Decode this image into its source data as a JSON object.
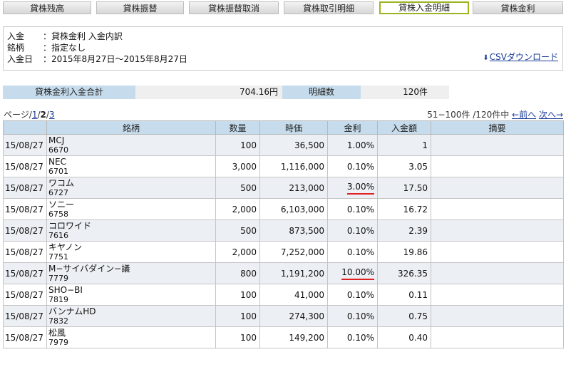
{
  "tabs": [
    {
      "label": "貸株残高",
      "active": false
    },
    {
      "label": "貸株振替",
      "active": false
    },
    {
      "label": "貸株振替取消",
      "active": false
    },
    {
      "label": "貸株取引明細",
      "active": false
    },
    {
      "label": "貸株入金明細",
      "active": true
    },
    {
      "label": "貸株金利",
      "active": false
    }
  ],
  "info": {
    "deposit_label": "入金",
    "deposit_value": "：貸株金利 入金内訳",
    "stock_label": "銘柄",
    "stock_value": "：指定なし",
    "date_label": "入金日",
    "date_value": "：2015年8月27日～2015年8月27日",
    "csv_link": "CSVダウンロード",
    "csv_icon": "download-arrow-icon"
  },
  "summary": {
    "total_label": "貸株金利入金合計",
    "total_value": "704.16円",
    "count_label": "明細数",
    "count_value": "120件"
  },
  "pager": {
    "prefix": "ページ",
    "slash1": "/",
    "page1": "1",
    "slash2": "/",
    "page2": "2",
    "slash3": "/",
    "page3": "3",
    "range": "51−100件 /120件中",
    "prev": "←前へ",
    "next": "次へ→"
  },
  "table": {
    "headers": [
      "",
      "銘柄",
      "数量",
      "時価",
      "金利",
      "入金額",
      "摘要"
    ],
    "rows": [
      {
        "date": "15/08/27",
        "name": "MCJ",
        "code": "6670",
        "qty": "100",
        "price": "36,500",
        "rate": "1.00%",
        "amount": "1",
        "memo": "",
        "highlight": false
      },
      {
        "date": "15/08/27",
        "name": "NEC",
        "code": "6701",
        "qty": "3,000",
        "price": "1,116,000",
        "rate": "0.10%",
        "amount": "3.05",
        "memo": "",
        "highlight": false
      },
      {
        "date": "15/08/27",
        "name": "ワコム",
        "code": "6727",
        "qty": "500",
        "price": "213,000",
        "rate": "3.00%",
        "amount": "17.50",
        "memo": "",
        "highlight": true
      },
      {
        "date": "15/08/27",
        "name": "ソニー",
        "code": "6758",
        "qty": "2,000",
        "price": "6,103,000",
        "rate": "0.10%",
        "amount": "16.72",
        "memo": "",
        "highlight": false
      },
      {
        "date": "15/08/27",
        "name": "コロワイド",
        "code": "7616",
        "qty": "500",
        "price": "873,500",
        "rate": "0.10%",
        "amount": "2.39",
        "memo": "",
        "highlight": false
      },
      {
        "date": "15/08/27",
        "name": "キヤノン",
        "code": "7751",
        "qty": "2,000",
        "price": "7,252,000",
        "rate": "0.10%",
        "amount": "19.86",
        "memo": "",
        "highlight": false
      },
      {
        "date": "15/08/27",
        "name": "M−サイバダイン−議",
        "code": "7779",
        "qty": "800",
        "price": "1,191,200",
        "rate": "10.00%",
        "amount": "326.35",
        "memo": "",
        "highlight": true
      },
      {
        "date": "15/08/27",
        "name": "SHO−BI",
        "code": "7819",
        "qty": "100",
        "price": "41,000",
        "rate": "0.10%",
        "amount": "0.11",
        "memo": "",
        "highlight": false
      },
      {
        "date": "15/08/27",
        "name": "バンナムHD",
        "code": "7832",
        "qty": "100",
        "price": "274,300",
        "rate": "0.10%",
        "amount": "0.75",
        "memo": "",
        "highlight": false
      },
      {
        "date": "15/08/27",
        "name": "松風",
        "code": "7979",
        "qty": "100",
        "price": "149,200",
        "rate": "0.10%",
        "amount": "0.40",
        "memo": "",
        "highlight": false
      }
    ]
  }
}
